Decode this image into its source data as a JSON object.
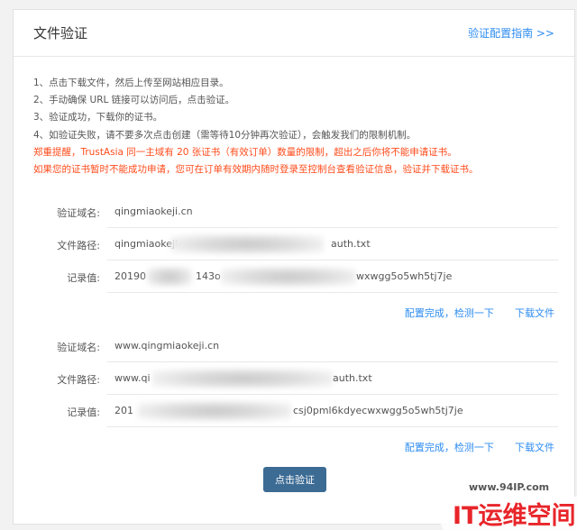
{
  "panel": {
    "title": "文件验证",
    "guide_link": "验证配置指南 >>"
  },
  "instructions": [
    {
      "text": "1、点击下载文件，然后上传至网站相应目录。",
      "warn": false
    },
    {
      "text": "2、手动确保 URL 链接可以访问后，点击验证。",
      "warn": false
    },
    {
      "text": "3、验证成功，下载你的证书。",
      "warn": false
    },
    {
      "text": "4、如验证失败，请不要多次点击创建（需等待10分钟再次验证），会触发我们的限制机制。",
      "warn": false
    },
    {
      "text": "郑重提醒，TrustAsia 同一主域有 20 张证书（有效订单）数量的限制，超出之后你将不能申请证书。",
      "warn": true
    },
    {
      "text": "如果您的证书暂时不能成功申请，您可在订单有效期内随时登录至控制台查看验证信息，验证并下载证书。",
      "warn": true
    }
  ],
  "records": [
    {
      "domain_label": "验证域名:",
      "domain_value": "qingmiaokeji.cn",
      "path_label": "文件路径:",
      "path_prefix": "qingmiaokeji",
      "path_suffix": "auth.txt",
      "record_label": "记录值:",
      "record_prefix": "20190",
      "record_mid": "143o",
      "record_suffix": "wxwgg5o5wh5tj7je",
      "action_config": "配置完成，检测一下",
      "action_download": "下载文件"
    },
    {
      "domain_label": "验证域名:",
      "domain_value": "www.qingmiaokeji.cn",
      "path_label": "文件路径:",
      "path_prefix": "www.qi",
      "path_suffix": "auth.txt",
      "record_label": "记录值:",
      "record_prefix": "201",
      "record_suffix": "csj0pml6kdyecwxwgg5o5wh5tj7je",
      "action_config": "配置完成，检测一下",
      "action_download": "下载文件"
    }
  ],
  "submit_label": "点击验证",
  "watermark": {
    "url": "www.94IP.com",
    "brand": "IT运维空间"
  },
  "colors": {
    "link": "#2d8cf0",
    "warn": "#ff4c1c",
    "button": "#3c6b94",
    "watermark": "#e8252a"
  }
}
